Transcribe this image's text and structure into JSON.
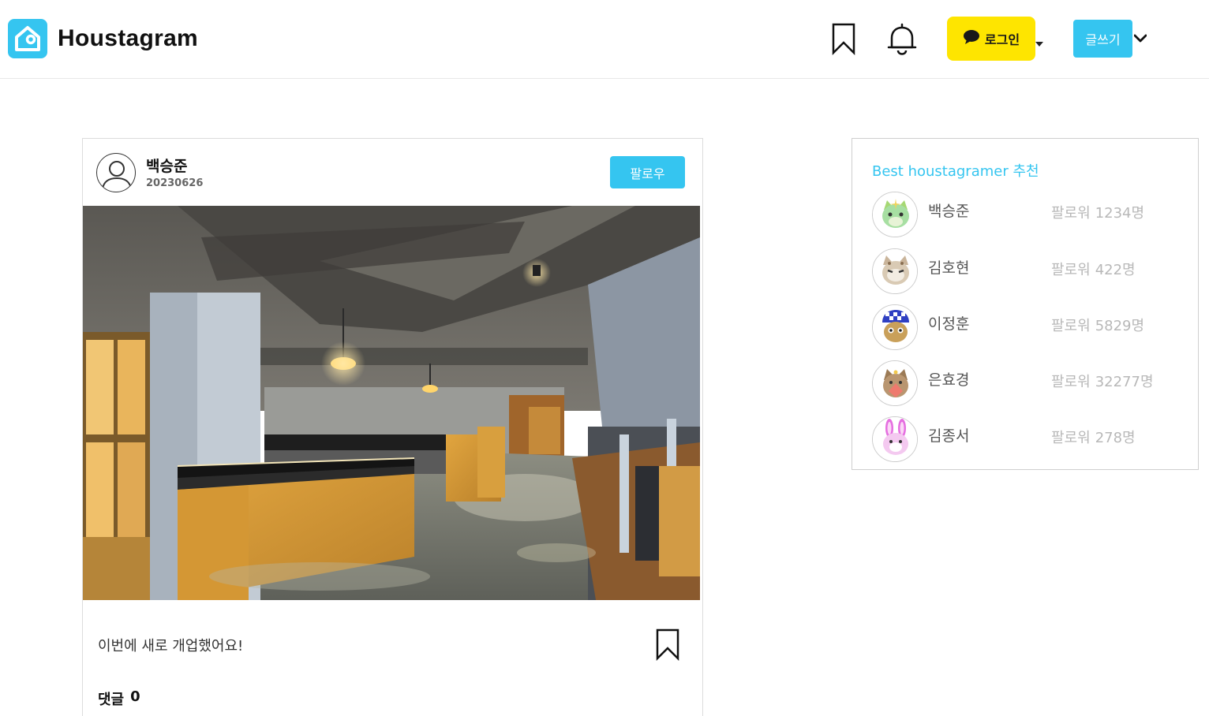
{
  "header": {
    "logo_text": "Houstagram",
    "login_label": "로그인",
    "write_label": "글쓰기"
  },
  "post": {
    "author_name": "백승준",
    "author_date": "20230626",
    "follow_label": "팔로우",
    "caption": "이번에 새로 개업했어요!",
    "comments_label": "댓글",
    "comments_count": "0"
  },
  "recommend": {
    "title": "Best houstagramer 추천",
    "followers_label": "팔로워",
    "users": [
      {
        "name": "백승준",
        "followers": "1234명"
      },
      {
        "name": "김호현",
        "followers": "422명"
      },
      {
        "name": "이정훈",
        "followers": "5829명"
      },
      {
        "name": "은효경",
        "followers": "32277명"
      },
      {
        "name": "김종서",
        "followers": "278명"
      }
    ]
  },
  "colors": {
    "brand": "#35c5f0",
    "kakao": "#fee500"
  },
  "icons": [
    "house-logo-icon",
    "bookmark-icon",
    "bell-icon",
    "chat-bubble-icon",
    "caret-down-icon",
    "chevron-down-icon",
    "user-avatar-icon"
  ]
}
